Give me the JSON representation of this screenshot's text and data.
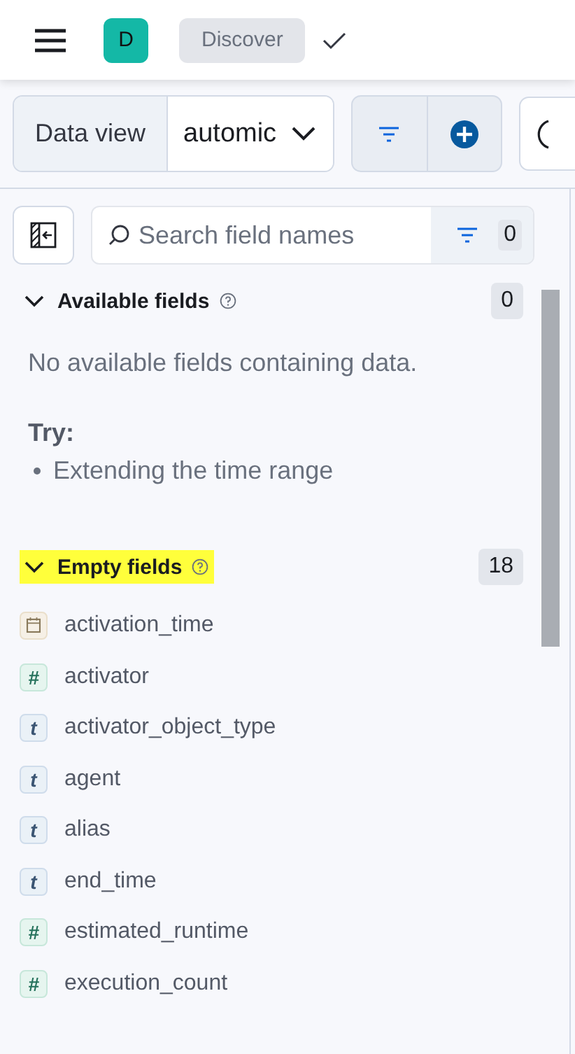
{
  "header": {
    "avatar": "D",
    "breadcrumb": "Discover"
  },
  "toolbar": {
    "data_view_label": "Data view",
    "data_view_value": "automic"
  },
  "sidebar": {
    "search": {
      "placeholder": "Search field names"
    },
    "filter_count": "0",
    "sections": [
      {
        "title": "Available fields",
        "count": "0",
        "expanded": true,
        "highlighted": false,
        "empty_message": "No available fields containing data.",
        "try_label": "Try:",
        "suggestions": [
          "Extending the time range"
        ]
      },
      {
        "title": "Empty fields",
        "count": "18",
        "expanded": true,
        "highlighted": true,
        "fields": [
          {
            "kind": "date",
            "name": "activation_time"
          },
          {
            "kind": "number",
            "badge": "#",
            "name": "activator"
          },
          {
            "kind": "string",
            "badge": "t",
            "name": "activator_object_type"
          },
          {
            "kind": "string",
            "badge": "t",
            "name": "agent"
          },
          {
            "kind": "string",
            "badge": "t",
            "name": "alias"
          },
          {
            "kind": "string",
            "badge": "t",
            "name": "end_time"
          },
          {
            "kind": "number",
            "badge": "#",
            "name": "estimated_runtime"
          },
          {
            "kind": "number",
            "badge": "#",
            "name": "execution_count"
          }
        ]
      }
    ]
  }
}
